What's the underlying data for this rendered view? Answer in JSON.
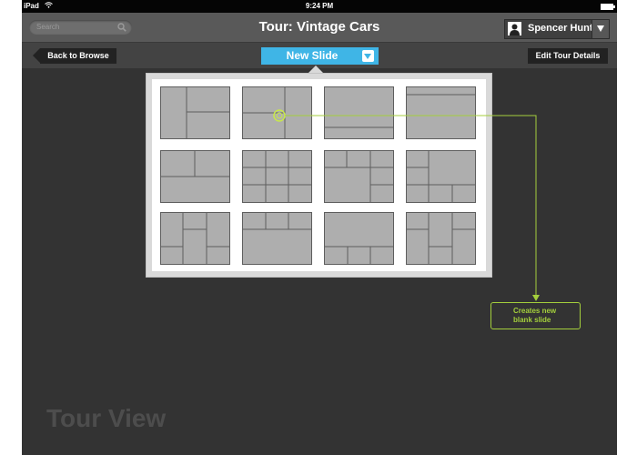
{
  "statusbar": {
    "device": "iPad",
    "time": "9:24 PM"
  },
  "header": {
    "search_placeholder": "Search",
    "title": "Tour: Vintage Cars",
    "user_name": "Spencer Hunt"
  },
  "toolbar": {
    "back_label": "Back to Browse",
    "new_slide_label": "New Slide",
    "edit_label": "Edit Tour Details"
  },
  "annotation": {
    "line1": "Creates new",
    "line2": "blank slide"
  },
  "watermark": "Tour View",
  "colors": {
    "accent": "#3fb5e6",
    "annotation": "#a4cf3c",
    "background": "#333333"
  }
}
